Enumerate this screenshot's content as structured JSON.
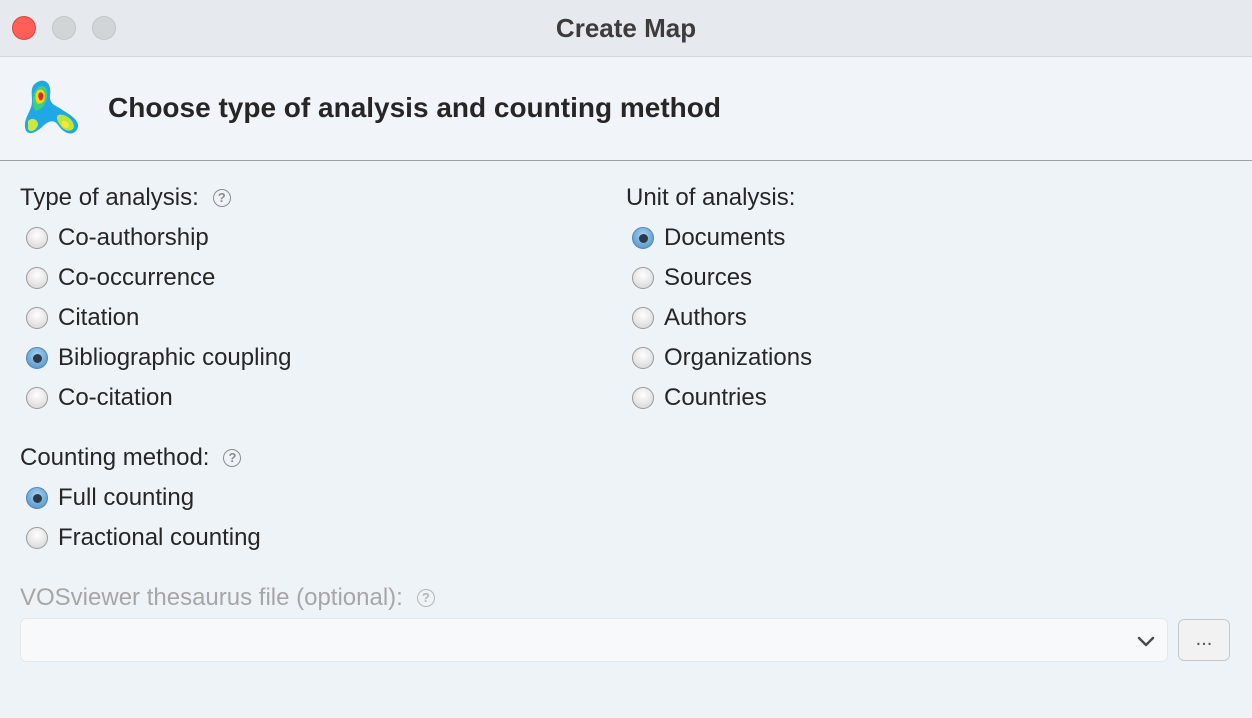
{
  "window": {
    "title": "Create Map"
  },
  "header": {
    "title": "Choose type of analysis and counting method"
  },
  "type_of_analysis": {
    "label": "Type of analysis:",
    "help": "?",
    "options": [
      {
        "label": "Co-authorship",
        "checked": false
      },
      {
        "label": "Co-occurrence",
        "checked": false
      },
      {
        "label": "Citation",
        "checked": false
      },
      {
        "label": "Bibliographic coupling",
        "checked": true
      },
      {
        "label": "Co-citation",
        "checked": false
      }
    ]
  },
  "unit_of_analysis": {
    "label": "Unit of analysis:",
    "options": [
      {
        "label": "Documents",
        "checked": true
      },
      {
        "label": "Sources",
        "checked": false
      },
      {
        "label": "Authors",
        "checked": false
      },
      {
        "label": "Organizations",
        "checked": false
      },
      {
        "label": "Countries",
        "checked": false
      }
    ]
  },
  "counting_method": {
    "label": "Counting method:",
    "help": "?",
    "options": [
      {
        "label": "Full counting",
        "checked": true
      },
      {
        "label": "Fractional counting",
        "checked": false
      }
    ]
  },
  "thesaurus": {
    "label": "VOSviewer thesaurus file (optional):",
    "help": "?",
    "value": "",
    "browse_label": "..."
  },
  "colors": {
    "accent": "#6ea8d6",
    "close": "#ff5f57",
    "disabled_text": "#a6a6a6"
  }
}
